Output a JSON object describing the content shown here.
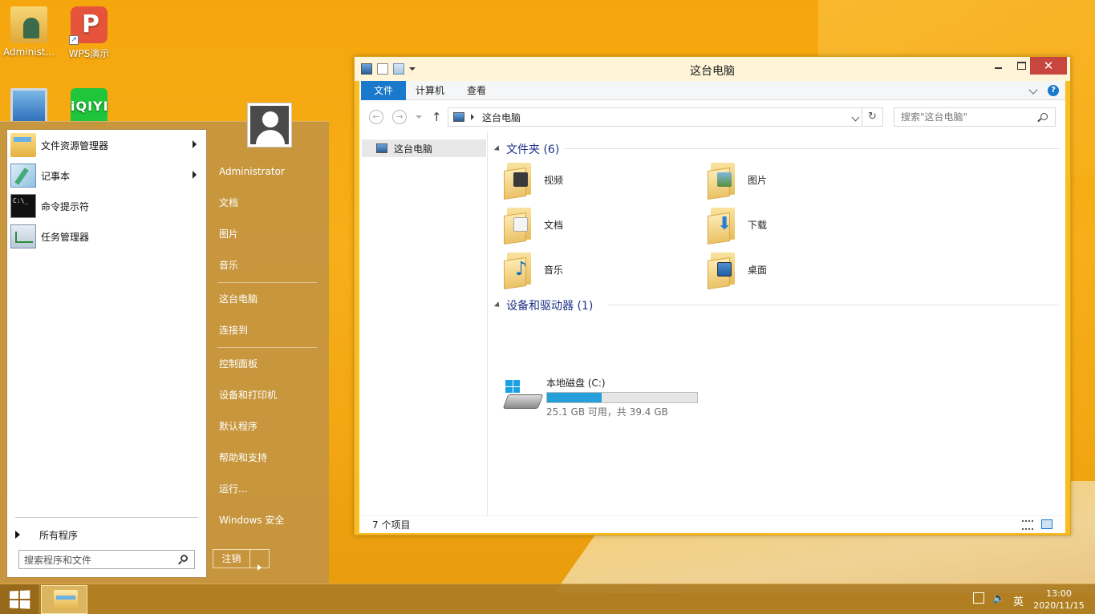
{
  "desktop": {
    "icons": [
      {
        "label": "Administ...",
        "icon": "user-folder-icon"
      },
      {
        "label": "WPS演示",
        "icon": "wps-presentation-icon"
      },
      {
        "label": "",
        "icon": "computer-icon"
      },
      {
        "label": "",
        "icon": "iqiyi-icon"
      }
    ],
    "iqiyi_text": "iQIYI"
  },
  "start_menu": {
    "programs": [
      {
        "label": "文件资源管理器",
        "icon": "file-explorer-icon",
        "has_submenu": true
      },
      {
        "label": "记事本",
        "icon": "notepad-icon",
        "has_submenu": true
      },
      {
        "label": "命令提示符",
        "icon": "cmd-icon",
        "has_submenu": false
      },
      {
        "label": "任务管理器",
        "icon": "task-manager-icon",
        "has_submenu": false
      }
    ],
    "cmd_icon_text": "C:\\_",
    "all_programs": "所有程序",
    "search_placeholder": "搜索程序和文件",
    "right": {
      "user": "Administrator",
      "items": [
        "文档",
        "图片",
        "音乐",
        "这台电脑",
        "连接到",
        "控制面板",
        "设备和打印机",
        "默认程序",
        "帮助和支持",
        "运行...",
        "Windows 安全"
      ]
    },
    "logout_label": "注销"
  },
  "explorer": {
    "title": "这台电脑",
    "close_glyph": "✕",
    "ribbon_tabs": [
      "文件",
      "计算机",
      "查看"
    ],
    "help_glyph": "?",
    "nav": {
      "back": "←",
      "forward": "→",
      "up": "↑",
      "refresh": "↻"
    },
    "address": "这台电脑",
    "search_placeholder": "搜索\"这台电脑\"",
    "nav_pane_item": "这台电脑",
    "folders_header": "文件夹 (6)",
    "folders": [
      {
        "label": "视频",
        "icon": "videos-folder-icon"
      },
      {
        "label": "图片",
        "icon": "pictures-folder-icon"
      },
      {
        "label": "文档",
        "icon": "documents-folder-icon"
      },
      {
        "label": "下载",
        "icon": "downloads-folder-icon"
      },
      {
        "label": "音乐",
        "icon": "music-folder-icon"
      },
      {
        "label": "桌面",
        "icon": "desktop-folder-icon"
      }
    ],
    "devices_header": "设备和驱动器 (1)",
    "drive": {
      "label": "本地磁盘 (C:)",
      "usage_fraction": 0.363,
      "detail": "25.1 GB 可用，共 39.4 GB"
    },
    "status": "7 个项目"
  },
  "taskbar": {
    "ime": "英",
    "time": "13:00",
    "date": "2020/11/15"
  },
  "colors": {
    "accent_blue": "#1979ca",
    "drive_fill": "#26a0da",
    "group_header": "#1e3287",
    "close_red": "#c7463d"
  }
}
